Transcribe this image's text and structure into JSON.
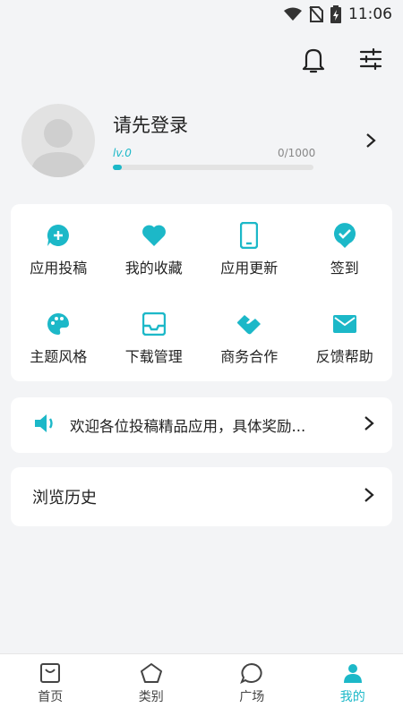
{
  "status_bar": {
    "time": "11:06"
  },
  "profile": {
    "title": "请先登录",
    "level": "lv.0",
    "exp_text": "0/1000",
    "progress": 0
  },
  "grid": [
    {
      "label": "应用投稿",
      "icon": "chat-plus-icon"
    },
    {
      "label": "我的收藏",
      "icon": "heart-icon"
    },
    {
      "label": "应用更新",
      "icon": "phone-icon"
    },
    {
      "label": "签到",
      "icon": "check-badge-icon"
    },
    {
      "label": "主题风格",
      "icon": "palette-icon"
    },
    {
      "label": "下载管理",
      "icon": "tray-icon"
    },
    {
      "label": "商务合作",
      "icon": "handshake-icon"
    },
    {
      "label": "反馈帮助",
      "icon": "mail-icon"
    }
  ],
  "notice": {
    "text": "欢迎各位投稿精品应用，具体奖励..."
  },
  "history": {
    "label": "浏览历史"
  },
  "bottom_nav": [
    {
      "label": "首页",
      "icon": "inbox-icon"
    },
    {
      "label": "类别",
      "icon": "pentagon-icon"
    },
    {
      "label": "广场",
      "icon": "chat-bubble-icon"
    },
    {
      "label": "我的",
      "icon": "person-icon",
      "active": true
    }
  ],
  "colors": {
    "accent": "#1cb8c8",
    "background": "#f3f4f6"
  }
}
